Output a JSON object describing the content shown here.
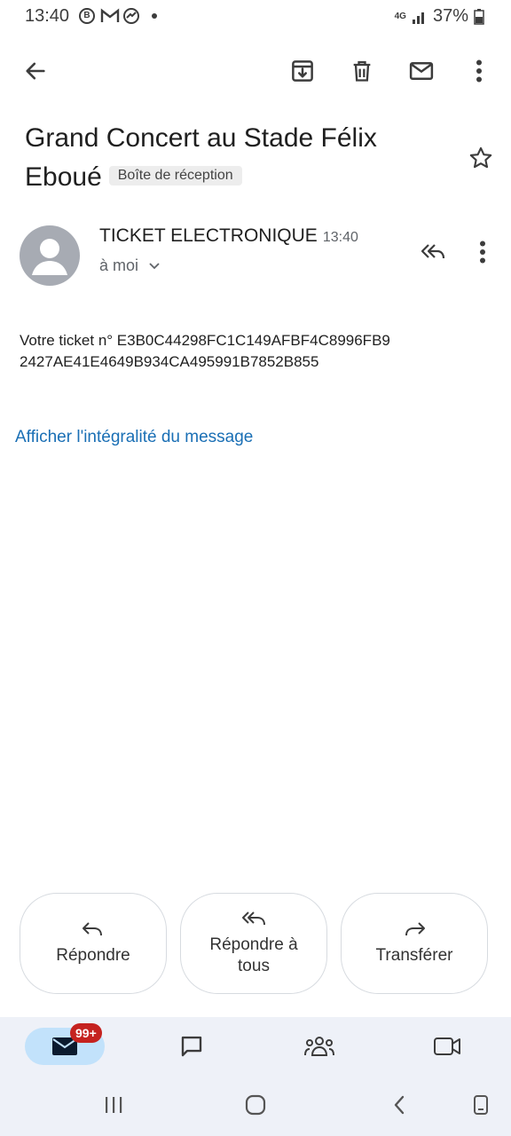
{
  "status_bar": {
    "time": "13:40",
    "notif_icons": [
      "b-circle-icon",
      "gmail-icon",
      "messenger-icon",
      "dot-icon"
    ],
    "network": "4G",
    "battery": "37%"
  },
  "toolbar": {
    "back": "arrow-left-icon",
    "archive": "archive-icon",
    "delete": "trash-icon",
    "mark_unread": "mail-icon",
    "more": "more-vert-icon"
  },
  "email": {
    "subject": "Grand Concert au Stade Félix Eboué",
    "label": "Boîte de réception",
    "sender": "TICKET ELECTRONIQUE",
    "time": "13:40",
    "recipient": "à moi",
    "body_line1": "Votre ticket n° E3B0C44298FC1C149AFBF4C8996FB9",
    "body_line2": "2427AE41E4649B934CA495991B7852B855",
    "full_message_link": "Afficher l'intégralité du message"
  },
  "actions": {
    "reply": "Répondre",
    "reply_all": "Répondre à tous",
    "forward": "Transférer"
  },
  "bottom_nav": {
    "mail_badge": "99+"
  },
  "colors": {
    "link": "#1a6fb5",
    "active_nav": "#c2e2fb",
    "badge": "#c5221f",
    "nav_bg": "#eef1f8"
  }
}
